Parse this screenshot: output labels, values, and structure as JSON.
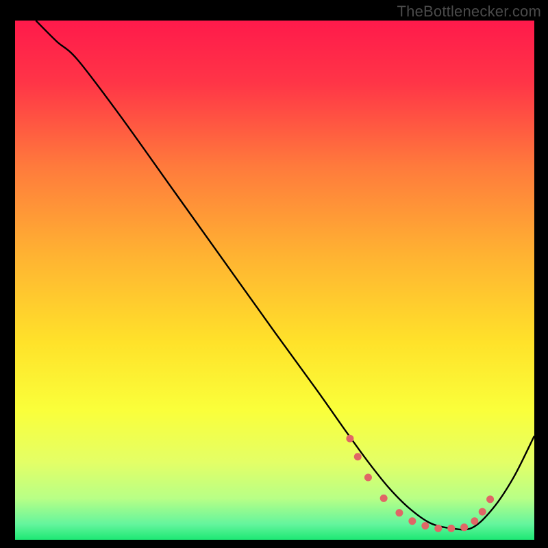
{
  "attribution": "TheBottlenecker.com",
  "chart_data": {
    "type": "line",
    "title": "",
    "xlabel": "",
    "ylabel": "",
    "xlim": [
      0,
      100
    ],
    "ylim": [
      0,
      100
    ],
    "grid": false,
    "legend": false,
    "background_gradient": {
      "stops": [
        {
          "offset": 0.0,
          "color": "#ff1a4b"
        },
        {
          "offset": 0.12,
          "color": "#ff3547"
        },
        {
          "offset": 0.28,
          "color": "#ff7a3c"
        },
        {
          "offset": 0.45,
          "color": "#ffb232"
        },
        {
          "offset": 0.62,
          "color": "#ffe22a"
        },
        {
          "offset": 0.75,
          "color": "#faff3a"
        },
        {
          "offset": 0.85,
          "color": "#e4ff66"
        },
        {
          "offset": 0.92,
          "color": "#b8ff86"
        },
        {
          "offset": 0.97,
          "color": "#64f59d"
        },
        {
          "offset": 1.0,
          "color": "#1de874"
        }
      ]
    },
    "series": [
      {
        "name": "curve",
        "color": "#000000",
        "x": [
          4,
          8,
          12,
          20,
          30,
          40,
          50,
          58,
          64,
          68,
          72,
          76,
          80,
          84,
          88,
          92,
          96,
          100
        ],
        "y": [
          100,
          96,
          92.5,
          82,
          68,
          54,
          40,
          29,
          20.5,
          15,
          10,
          6,
          3.2,
          2.2,
          2.3,
          6,
          12,
          20
        ]
      }
    ],
    "markers": {
      "name": "highlight-dots",
      "color": "#e06666",
      "radius": 5.5,
      "x": [
        64.5,
        66,
        68,
        71,
        74,
        76.5,
        79,
        81.5,
        84,
        86.5,
        88.5,
        90,
        91.5
      ],
      "y": [
        19.5,
        16,
        12,
        8,
        5.2,
        3.6,
        2.7,
        2.2,
        2.2,
        2.4,
        3.6,
        5.4,
        7.8
      ]
    }
  }
}
